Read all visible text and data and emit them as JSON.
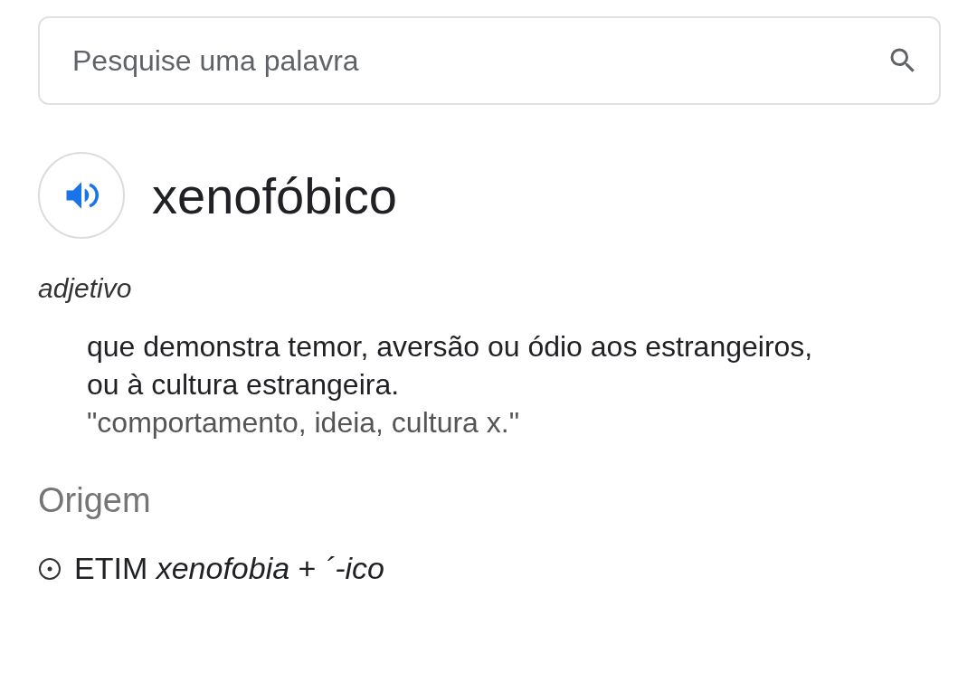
{
  "search": {
    "placeholder": "Pesquise uma palavra"
  },
  "entry": {
    "word": "xenofóbico",
    "part_of_speech": "adjetivo",
    "definition": "que demonstra temor, aversão ou ódio aos estrangeiros, ou à cultura estrangeira.",
    "example": "\"comportamento, ideia, cultura x.\""
  },
  "origin": {
    "heading": "Origem",
    "etymology": "ETIM *xenofobia* + *´-ico*"
  }
}
